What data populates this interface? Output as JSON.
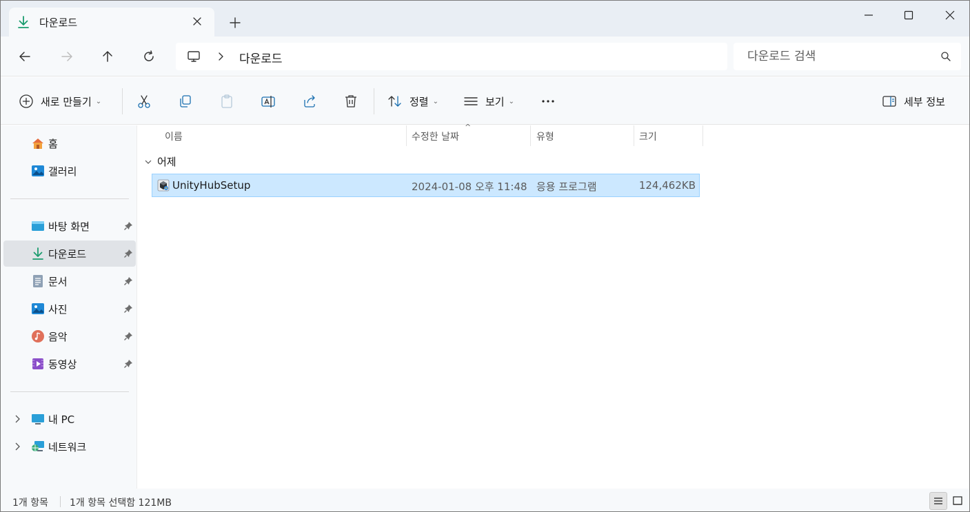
{
  "tab": {
    "title": "다운로드"
  },
  "address": {
    "crumb": "다운로드"
  },
  "search": {
    "placeholder": "다운로드 검색"
  },
  "toolbar": {
    "new_label": "새로 만들기",
    "sort_label": "정렬",
    "view_label": "보기",
    "details_label": "세부 정보"
  },
  "sidebar": {
    "quick": [
      {
        "label": "홈"
      },
      {
        "label": "갤러리"
      }
    ],
    "pinned": [
      {
        "label": "바탕 화면"
      },
      {
        "label": "다운로드"
      },
      {
        "label": "문서"
      },
      {
        "label": "사진"
      },
      {
        "label": "음악"
      },
      {
        "label": "동영상"
      }
    ],
    "devices": [
      {
        "label": "내 PC"
      },
      {
        "label": "네트워크"
      }
    ]
  },
  "columns": {
    "name": "이름",
    "modified": "수정한 날짜",
    "type": "유형",
    "size": "크기"
  },
  "groups": [
    {
      "label": "어제",
      "files": [
        {
          "name": "UnityHubSetup",
          "modified": "2024-01-08 오후 11:48",
          "type": "응용 프로그램",
          "size": "124,462KB"
        }
      ]
    }
  ],
  "status": {
    "count": "1개 항목",
    "selection": "1개 항목 선택함 121MB"
  },
  "colors": {
    "accent": "#0a7cbf",
    "selection_bg": "#cce8ff",
    "selection_border": "#99d1ff",
    "download_green": "#1a9c6e"
  }
}
